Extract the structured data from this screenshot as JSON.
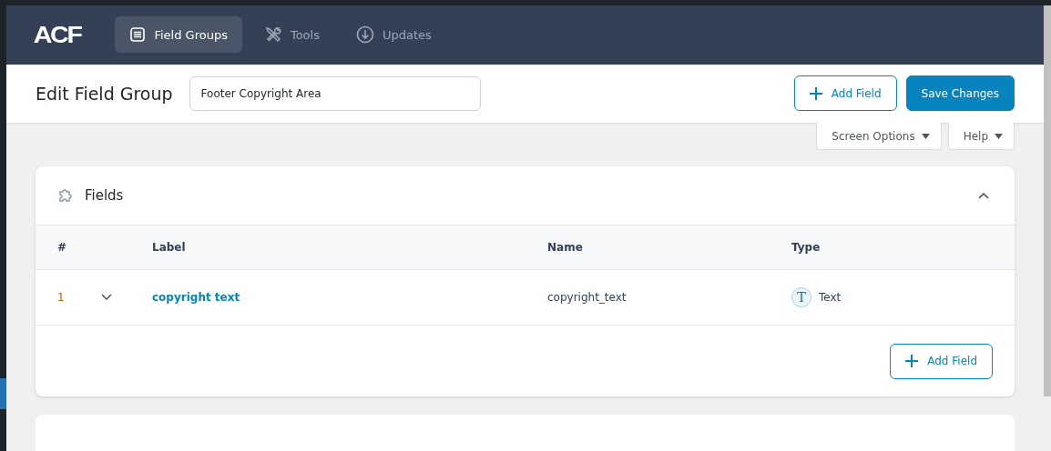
{
  "nav": {
    "logo": "ACF",
    "items": [
      {
        "label": "Field Groups",
        "kind": "groups",
        "selected": true
      },
      {
        "label": "Tools",
        "kind": "tools",
        "selected": false
      },
      {
        "label": "Updates",
        "kind": "updates",
        "selected": false
      }
    ]
  },
  "header": {
    "title": "Edit Field Group",
    "title_field": {
      "value": "Footer Copyright Area"
    },
    "add_button": "Add Field",
    "save_button": "Save Changes"
  },
  "screen_meta": [
    "Screen Options",
    "Help"
  ],
  "fields_panel": {
    "title": "Fields",
    "expanded": true,
    "columns": [
      "#",
      "Label",
      "Name",
      "Type"
    ],
    "rows": [
      {
        "number": "1",
        "label": "copyright text",
        "name": "copyright_text",
        "type_icon": "T",
        "type": "Text"
      }
    ],
    "add_button": "Add Field"
  }
}
